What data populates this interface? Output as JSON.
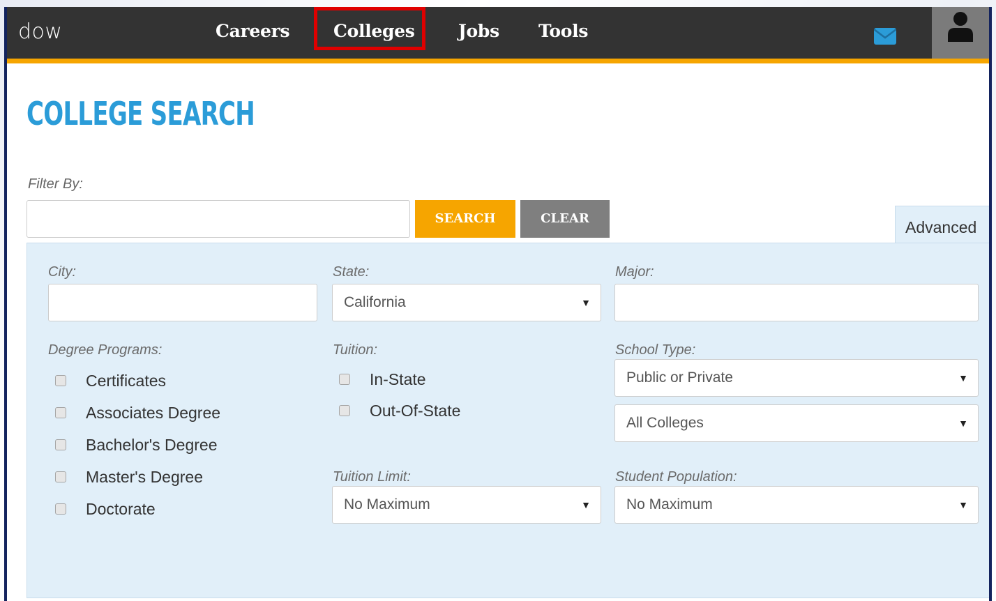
{
  "topbar": {
    "brand": "dow",
    "nav": [
      "Careers",
      "Colleges",
      "Jobs",
      "Tools"
    ]
  },
  "page": {
    "title": "COLLEGE SEARCH",
    "filter_label": "Filter By:",
    "filter_value": "",
    "search_button": "SEARCH",
    "clear_button": "CLEAR",
    "advanced_tab": "Advanced"
  },
  "advanced": {
    "city_label": "City:",
    "city_value": "",
    "state_label": "State:",
    "state_value": "California",
    "major_label": "Major:",
    "major_value": "",
    "degree_label": "Degree Programs:",
    "degrees": [
      "Certificates",
      "Associates Degree",
      "Bachelor's Degree",
      "Master's Degree",
      "Doctorate"
    ],
    "tuition_label": "Tuition:",
    "tuition_options": [
      "In-State",
      "Out-Of-State"
    ],
    "school_type_label": "School Type:",
    "school_type_value": "Public or Private",
    "college_kind_value": "All Colleges",
    "tuition_limit_label": "Tuition Limit:",
    "tuition_limit_value": "No Maximum",
    "population_label": "Student Population:",
    "population_value": "No Maximum",
    "dropdown_arrow": "▼"
  },
  "colors": {
    "nav_bg": "#333333",
    "accent_orange": "#f6a500",
    "title_blue": "#2b9cd8",
    "panel_bg": "#e1eff9",
    "highlight_red": "#e00000"
  }
}
